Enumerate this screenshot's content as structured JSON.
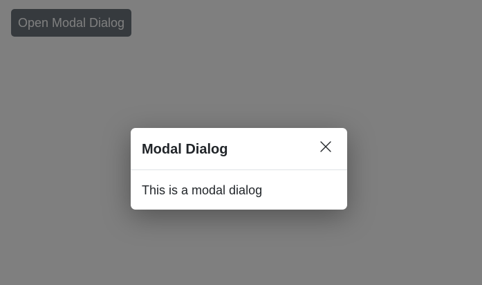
{
  "page": {
    "open_button_label": "Open Modal Dialog"
  },
  "modal": {
    "title": "Modal Dialog",
    "body_text": "This is a modal dialog",
    "close_icon": "close-icon"
  },
  "colors": {
    "button_bg": "#6c757d",
    "backdrop": "rgba(0,0,0,0.5)",
    "modal_bg": "#ffffff",
    "text": "#212529",
    "divider": "#dee2e6"
  }
}
